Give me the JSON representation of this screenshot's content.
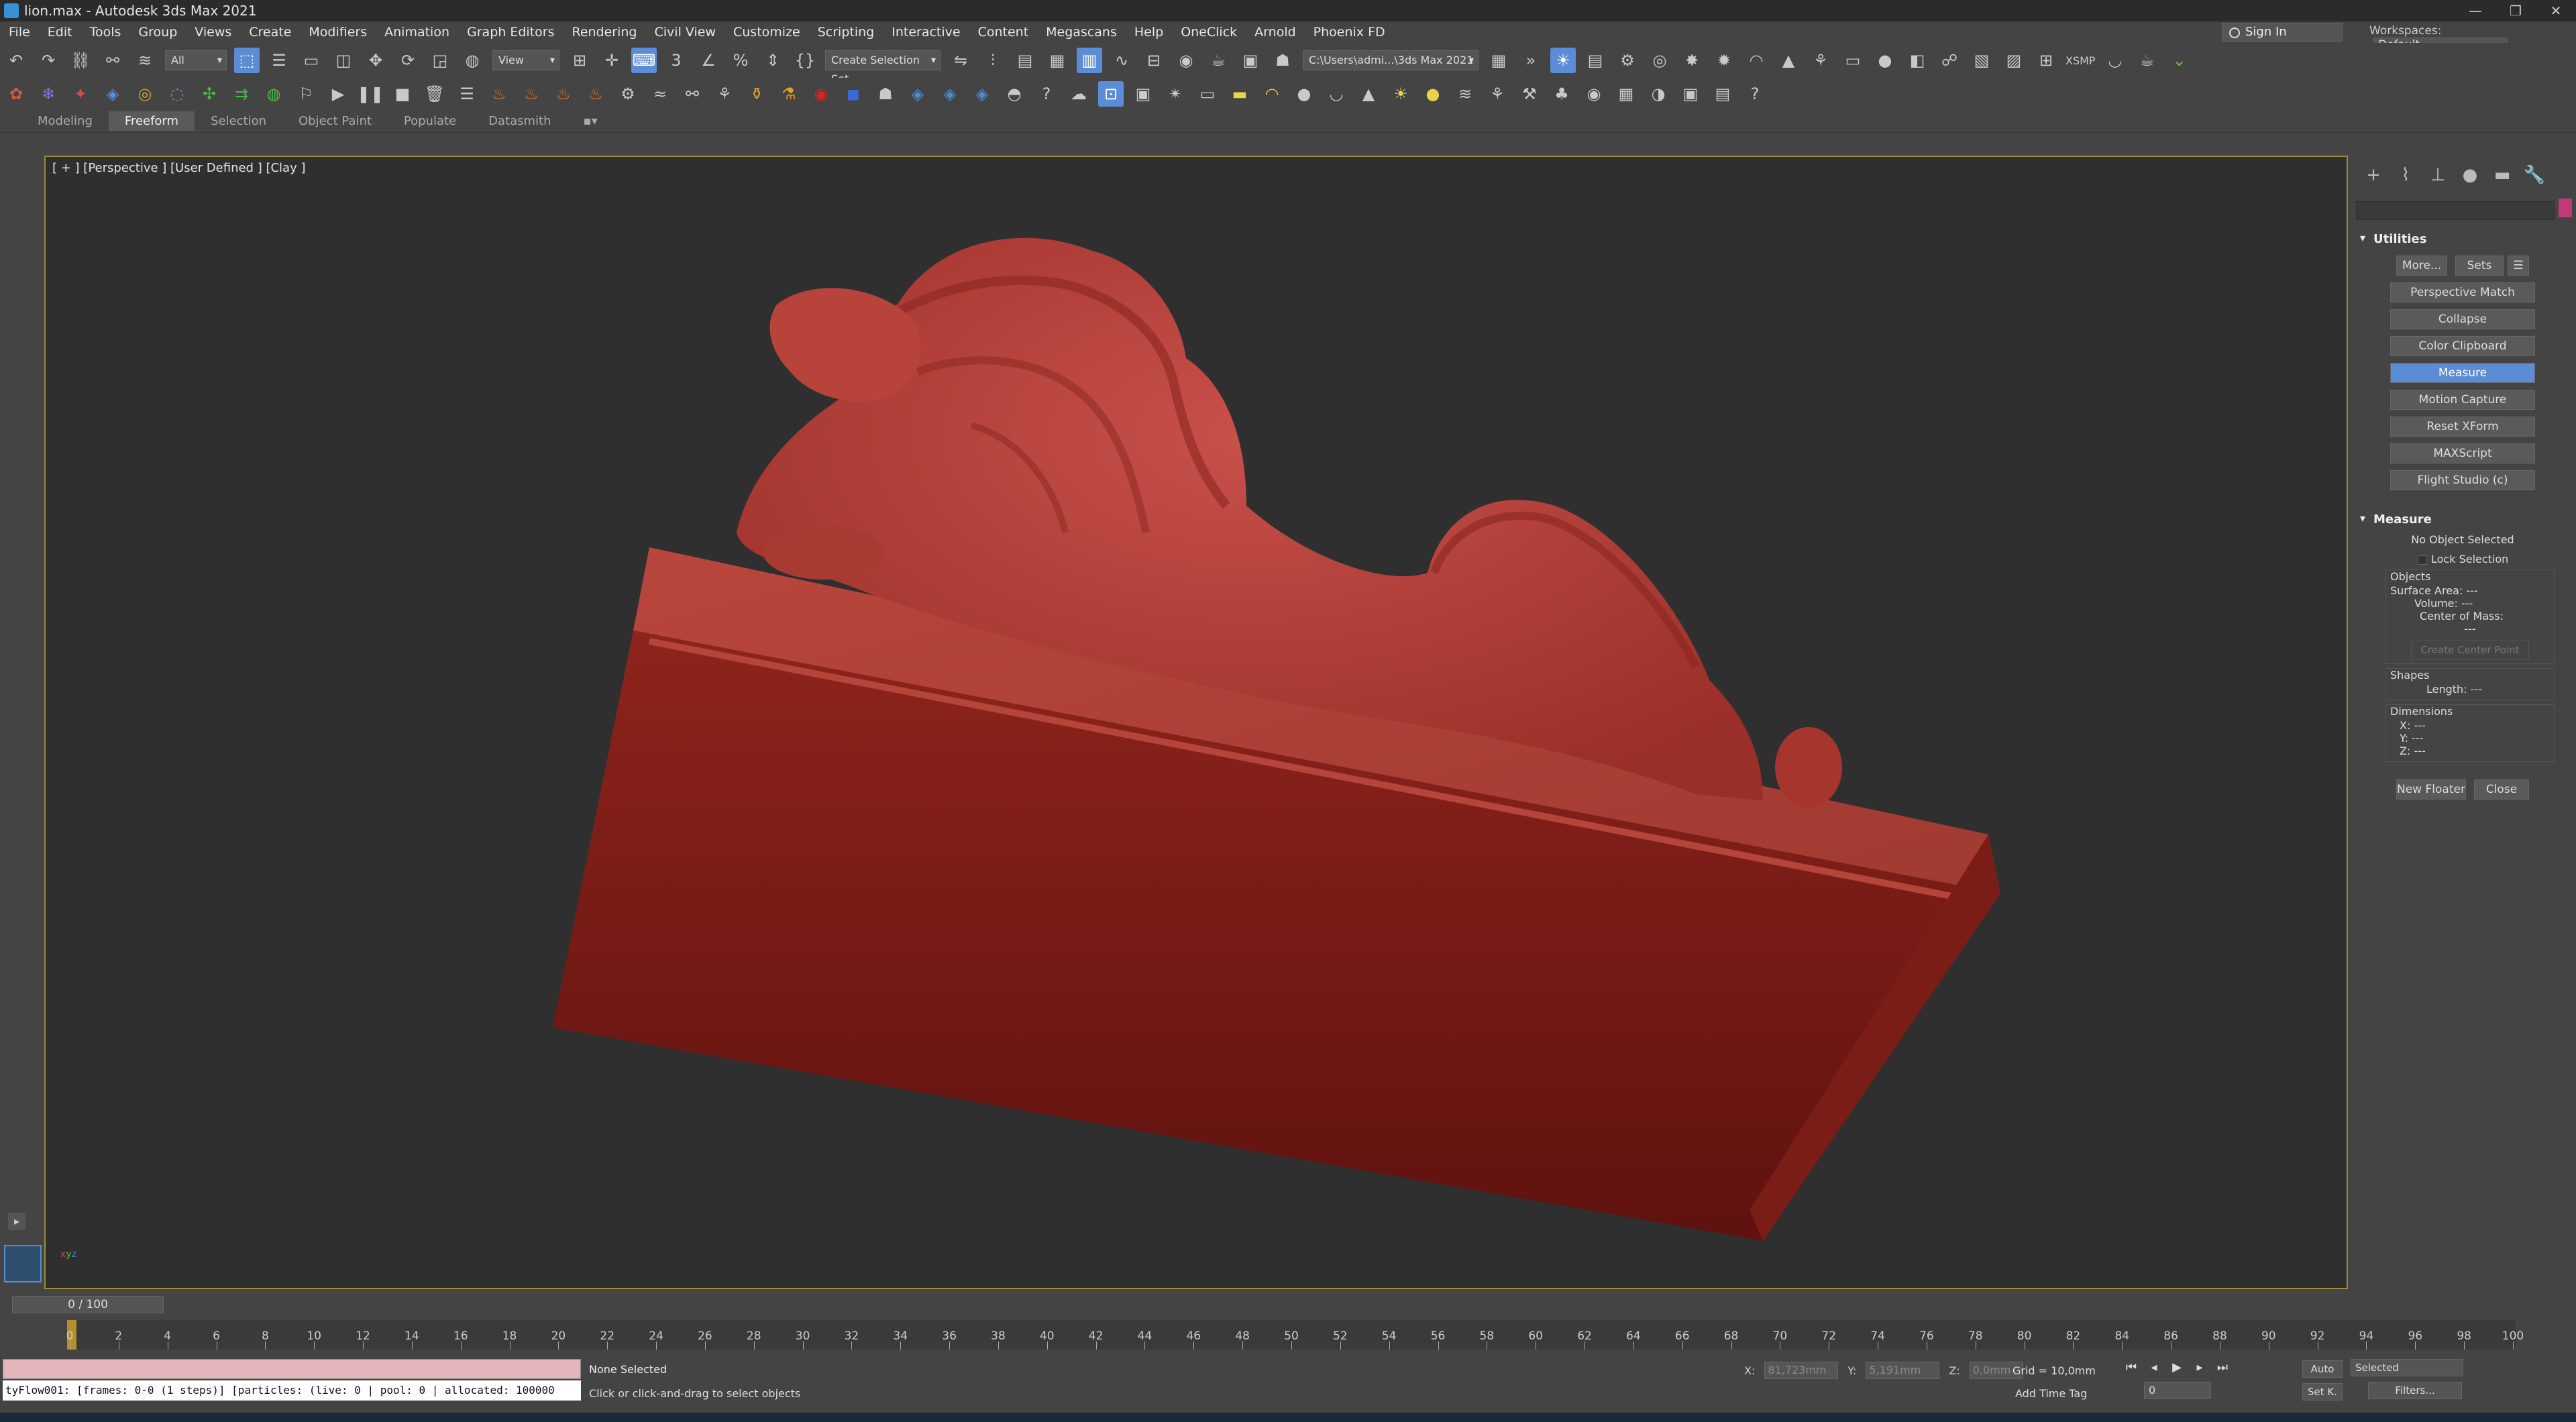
{
  "window": {
    "title": "lion.max - Autodesk 3ds Max 2021",
    "controls": [
      "—",
      "❐",
      "✕"
    ]
  },
  "menu": [
    "File",
    "Edit",
    "Tools",
    "Group",
    "Views",
    "Create",
    "Modifiers",
    "Animation",
    "Graph Editors",
    "Rendering",
    "Civil View",
    "Customize",
    "Scripting",
    "Interactive",
    "Content",
    "Megascans",
    "Help",
    "OneClick",
    "Arnold",
    "Phoenix FD"
  ],
  "account": {
    "sign_in": "Sign In",
    "workspaces_label": "Workspaces:",
    "workspace_value": "Default"
  },
  "main_toolbar": {
    "selection_filter": "All",
    "ref_coord": "View",
    "named_selection": "Create Selection Set",
    "project_path": "C:\\Users\\admi...\\3ds Max 2021",
    "xsmp": "XSMP"
  },
  "ribbon_tabs": [
    "Modeling",
    "Freeform",
    "Selection",
    "Object Paint",
    "Populate",
    "Datasmith"
  ],
  "ribbon_active": "Freeform",
  "viewport": {
    "label": "[ + ] [Perspective ] [User Defined ] [Clay ]",
    "object_color": "#b03a33",
    "background": "#2f2f2f"
  },
  "command_panel": {
    "utilities_title": "Utilities",
    "more_button": "More...",
    "sets_button": "Sets",
    "utilities": [
      "Perspective Match",
      "Collapse",
      "Color Clipboard",
      "Measure",
      "Motion Capture",
      "Reset XForm",
      "MAXScript",
      "Flight Studio (c)"
    ],
    "active_utility": "Measure",
    "measure": {
      "title": "Measure",
      "status": "No Object Selected",
      "lock_selection": "Lock Selection",
      "objects_label": "Objects",
      "surface_area": "Surface Area: ---",
      "volume": "Volume: ---",
      "center_of_mass": "Center of Mass:",
      "center_value": "---",
      "create_center_point": "Create Center Point",
      "shapes_label": "Shapes",
      "length": "Length: ---",
      "dimensions_label": "Dimensions",
      "x": "X: ---",
      "y": "Y: ---",
      "z": "Z: ---"
    },
    "new_floater": "New Floater",
    "close": "Close"
  },
  "timeline": {
    "slider_label": "0 / 100",
    "ticks": [
      "0",
      "2",
      "4",
      "6",
      "8",
      "10",
      "12",
      "14",
      "16",
      "18",
      "20",
      "22",
      "24",
      "26",
      "28",
      "30",
      "32",
      "34",
      "36",
      "38",
      "40",
      "42",
      "44",
      "46",
      "48",
      "50",
      "52",
      "54",
      "56",
      "58",
      "60",
      "62",
      "64",
      "66",
      "68",
      "70",
      "72",
      "74",
      "76",
      "78",
      "80",
      "82",
      "84",
      "86",
      "88",
      "90",
      "92",
      "94",
      "96",
      "98",
      "100"
    ]
  },
  "status": {
    "tyflow": "tyFlow001: [frames: 0-0 (1 steps)] [particles: (live: 0 | pool: 0 | allocated: 100000",
    "selection": "None Selected",
    "prompt": "Click or click-and-drag to select objects",
    "x": "X:",
    "x_value": "81,723mm",
    "y": "Y:",
    "y_value": "5,191mm",
    "z": "Z:",
    "z_value": "0,0mm",
    "grid": "Grid = 10,0mm",
    "add_time_tag": "Add Time Tag",
    "frame": "0",
    "auto": "Auto",
    "set_key": "Set K.",
    "key_filter": "Selected",
    "filters": "Filters..."
  }
}
